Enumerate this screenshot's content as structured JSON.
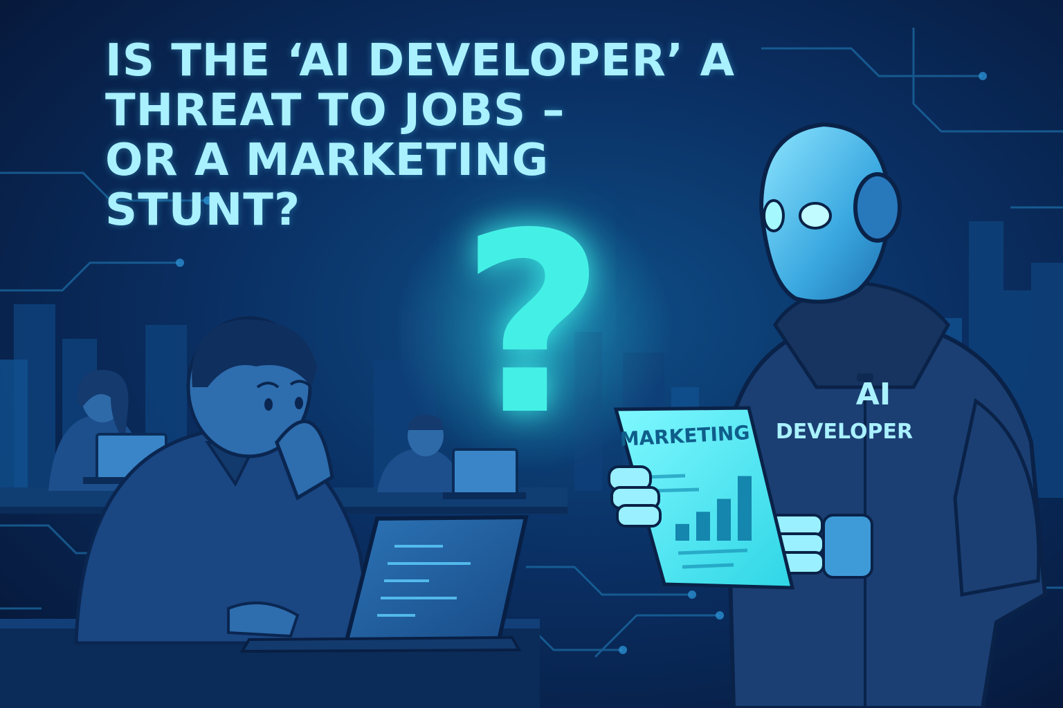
{
  "headline": {
    "lines": [
      "IS THE ‘AI DEVELOPER’ A",
      "THREAT TO JOBS –",
      "OR A MARKETING",
      "STUNT?"
    ]
  },
  "question_mark": "?",
  "robot": {
    "hoodie_text_line1": "AI",
    "hoodie_text_line2": "DEVELOPER",
    "document_title": "MARKETING",
    "document_bars": [
      0.22,
      0.38,
      0.55,
      0.85
    ]
  },
  "colors": {
    "background_dark": "#061534",
    "background_mid": "#0e4e86",
    "headline_text": "#a9f1ff",
    "accent_cyan": "#44f0e6",
    "circuit_lines": "#1c6fa8"
  }
}
